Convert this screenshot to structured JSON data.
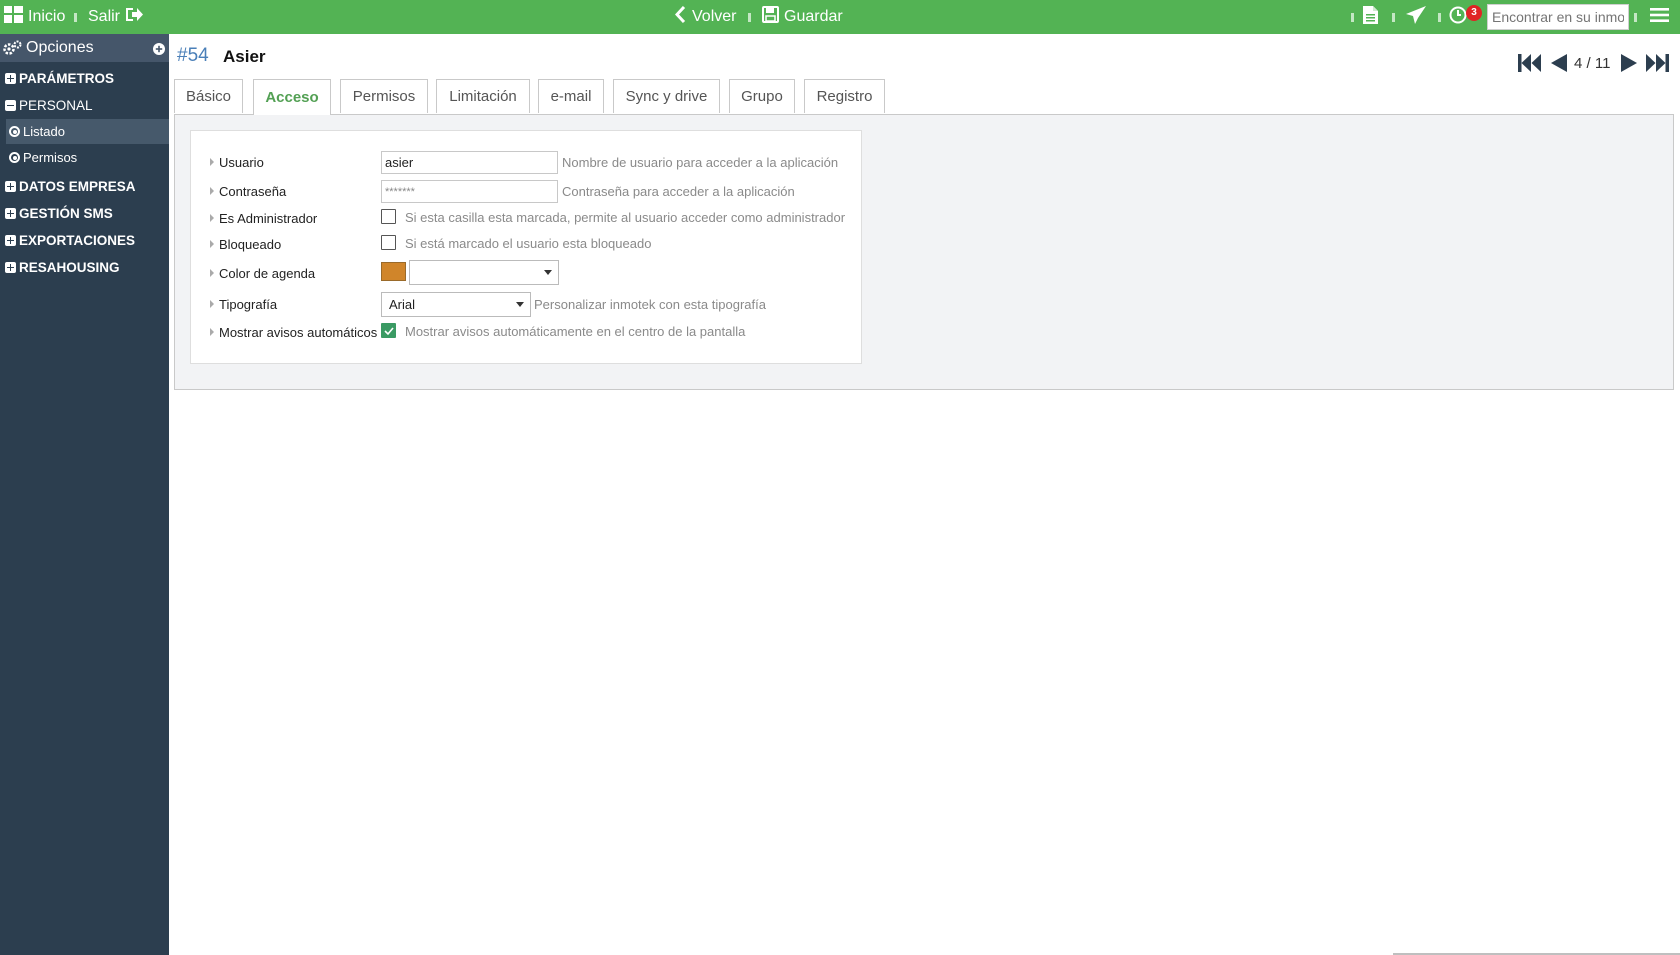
{
  "topbar": {
    "inicio": "Inicio",
    "salir": "Salir",
    "volver": "Volver",
    "guardar": "Guardar",
    "notification_count": "3",
    "search_placeholder": "Encontrar en su inmotek"
  },
  "sidebar": {
    "title": "Opciones",
    "sections": [
      {
        "label": "PARÁMETROS",
        "expanded": false
      },
      {
        "label": "PERSONAL",
        "expanded": true,
        "items": [
          {
            "label": "Listado",
            "active": true
          },
          {
            "label": "Permisos",
            "active": false
          }
        ]
      },
      {
        "label": "DATOS EMPRESA",
        "expanded": false
      },
      {
        "label": "GESTIÓN SMS",
        "expanded": false
      },
      {
        "label": "EXPORTACIONES",
        "expanded": false
      },
      {
        "label": "RESAHOUSING",
        "expanded": false
      }
    ]
  },
  "record": {
    "id": "#54",
    "name": "Asier",
    "pager": "4 / 11"
  },
  "tabs": [
    {
      "label": "Básico"
    },
    {
      "label": "Acceso",
      "active": true
    },
    {
      "label": "Permisos"
    },
    {
      "label": "Limitación"
    },
    {
      "label": "e-mail"
    },
    {
      "label": "Sync y drive"
    },
    {
      "label": "Grupo"
    },
    {
      "label": "Registro"
    }
  ],
  "form": {
    "usuario": {
      "label": "Usuario",
      "value": "asier",
      "hint": "Nombre de usuario para acceder a la aplicación"
    },
    "contrasena": {
      "label": "Contraseña",
      "value": "*******",
      "hint": "Contraseña para acceder a la aplicación"
    },
    "es_admin": {
      "label": "Es Administrador",
      "checked": false,
      "hint": "Si esta casilla esta marcada, permite al usuario acceder como administrador"
    },
    "bloqueado": {
      "label": "Bloqueado",
      "checked": false,
      "hint": "Si está marcado el usuario esta bloqueado"
    },
    "color_agenda": {
      "label": "Color de agenda",
      "color": "#d0852a",
      "value": ""
    },
    "tipografia": {
      "label": "Tipografía",
      "value": "Arial",
      "hint": "Personalizar inmotek con esta tipografía"
    },
    "avisos": {
      "label": "Mostrar avisos automáticos",
      "checked": true,
      "hint": "Mostrar avisos automáticamente en el centro de la pantalla"
    }
  },
  "colors": {
    "topbar": "#53b354",
    "sidebar": "#2c3e4f",
    "active_tab": "#53a054",
    "record_id": "#4a7fb8"
  }
}
